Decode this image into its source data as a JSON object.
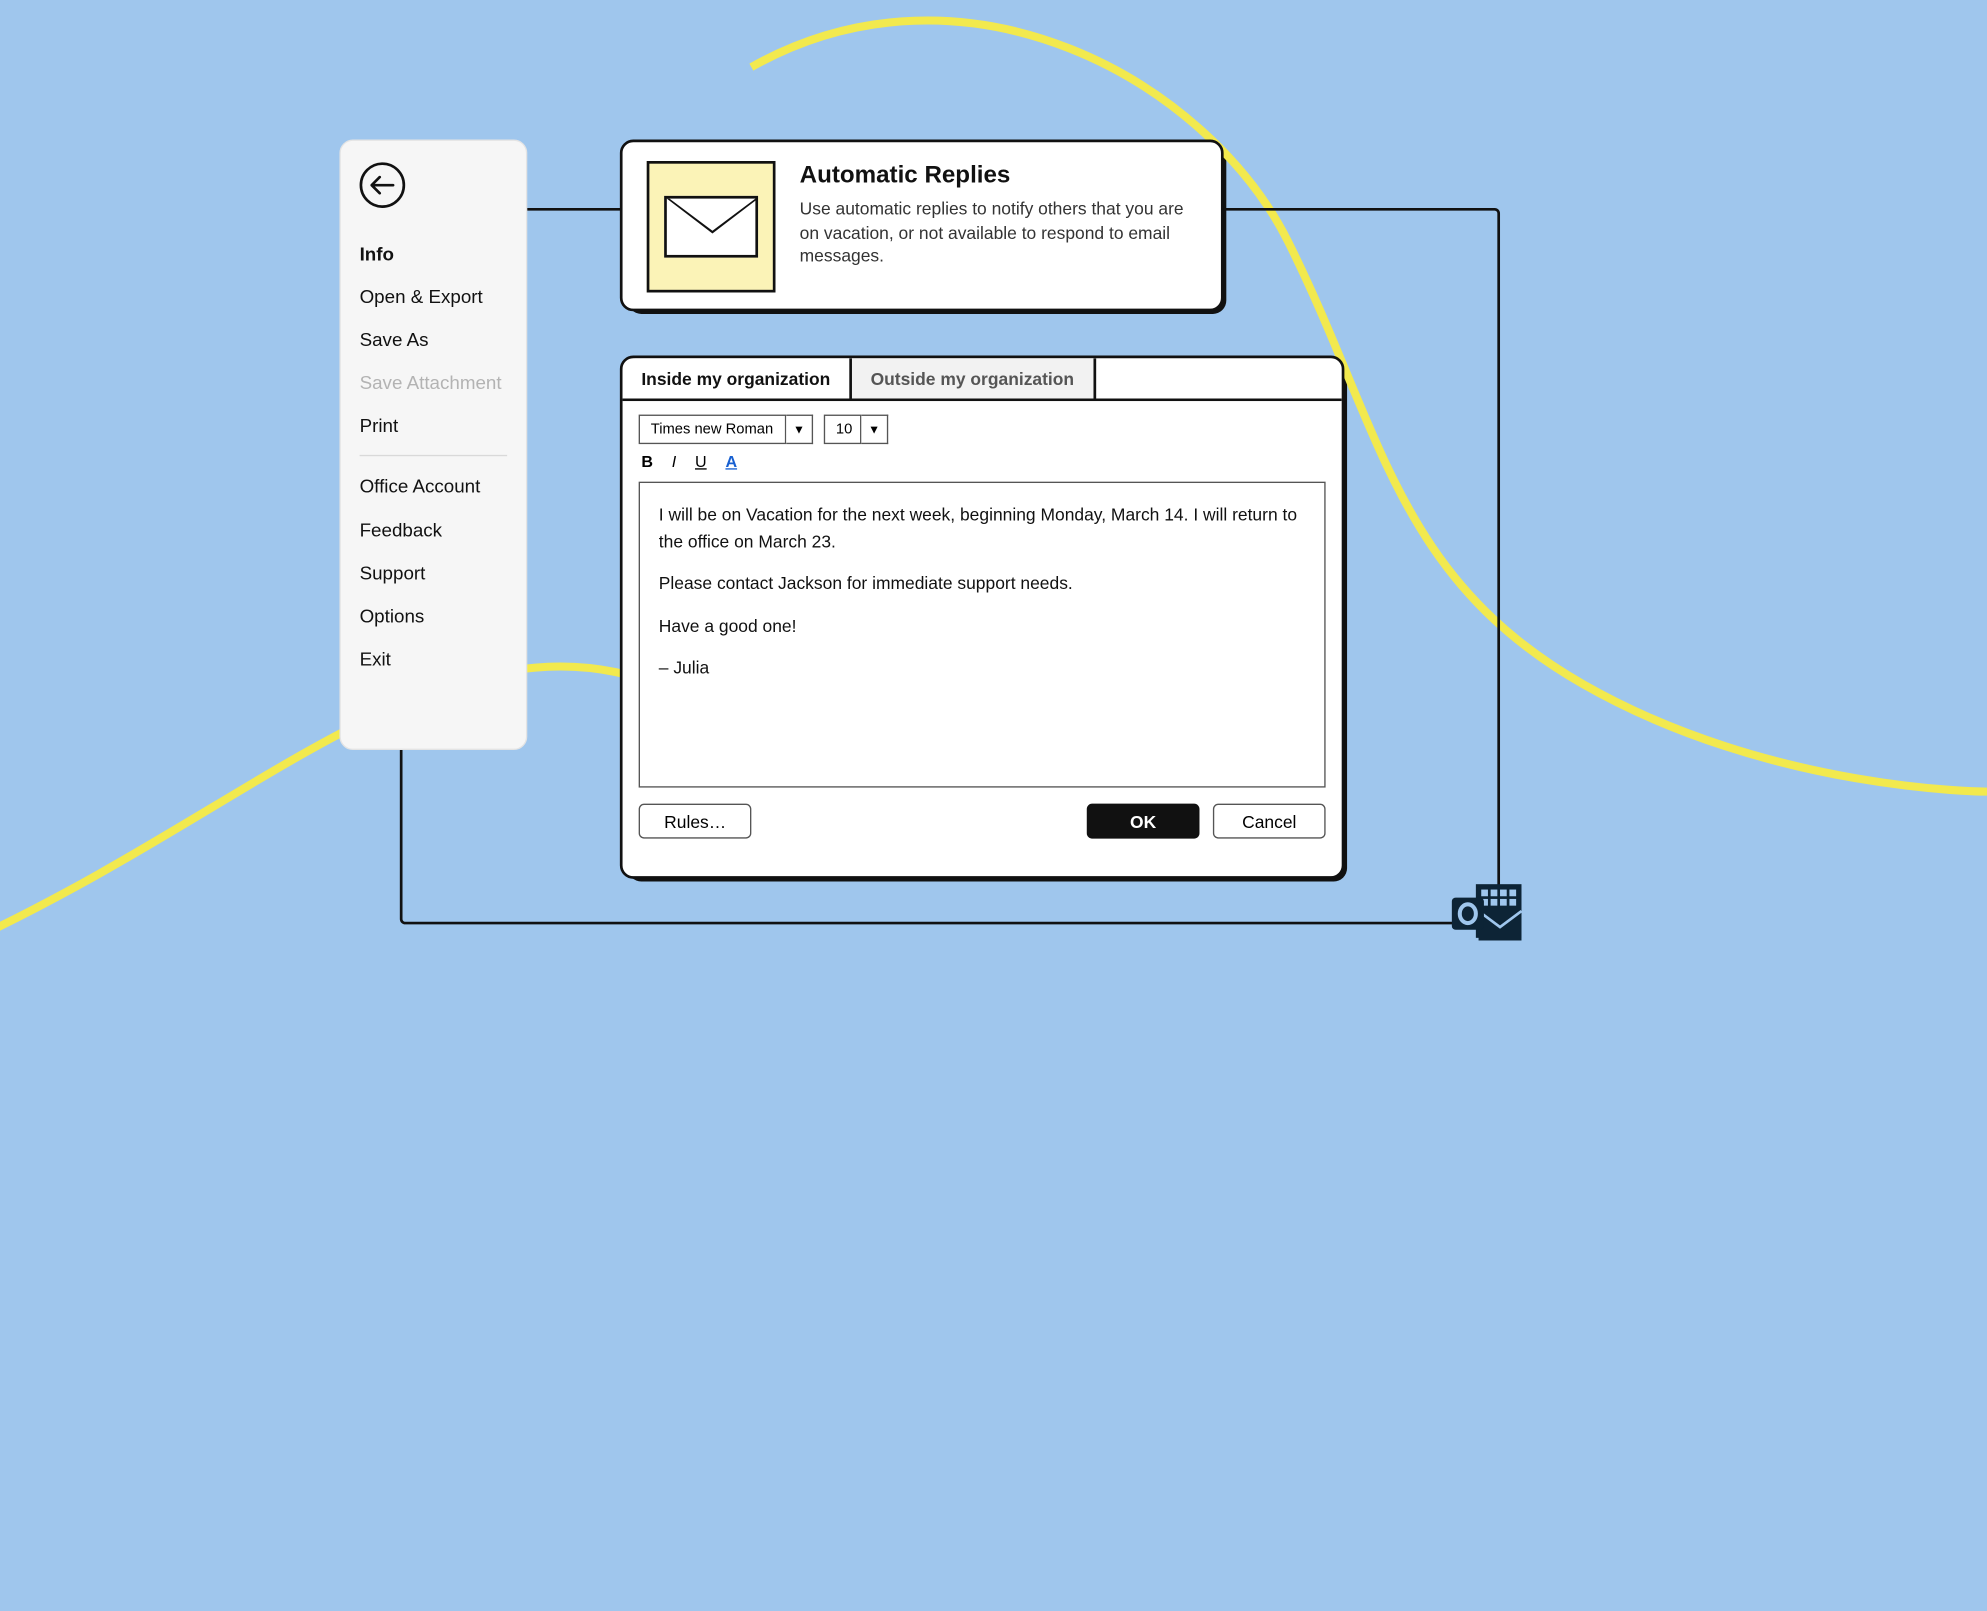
{
  "sidebar": {
    "items": [
      {
        "label": "Info",
        "active": true
      },
      {
        "label": "Open & Export"
      },
      {
        "label": "Save As"
      },
      {
        "label": "Save Attachment",
        "disabled": true
      },
      {
        "label": "Print"
      },
      {
        "label": "Office Account",
        "group2": true
      },
      {
        "label": "Feedback"
      },
      {
        "label": "Support"
      },
      {
        "label": "Options"
      },
      {
        "label": "Exit"
      }
    ]
  },
  "topcard": {
    "title": "Automatic Replies",
    "desc": "Use automatic replies to notify others that you are on vacation, or not available to respond to email messages."
  },
  "editor": {
    "tabs": {
      "inside": "Inside my organization",
      "outside": "Outside my organization"
    },
    "font_name": "Times new Roman",
    "font_size": "10",
    "format": {
      "b": "B",
      "i": "I",
      "u": "U",
      "a": "A"
    },
    "body": {
      "p1": "I will be on Vacation for the next week, beginning Monday, March 14. I will return to the office on March 23.",
      "p2": "Please contact Jackson for immediate support needs.",
      "p3": "Have a good one!",
      "p4": "– Julia"
    },
    "buttons": {
      "rules": "Rules…",
      "ok": "OK",
      "cancel": "Cancel"
    }
  },
  "colors": {
    "bg": "#9fc6ed",
    "yellow": "#f2e94e",
    "ink": "#111111",
    "cream": "#fbf3b7"
  }
}
